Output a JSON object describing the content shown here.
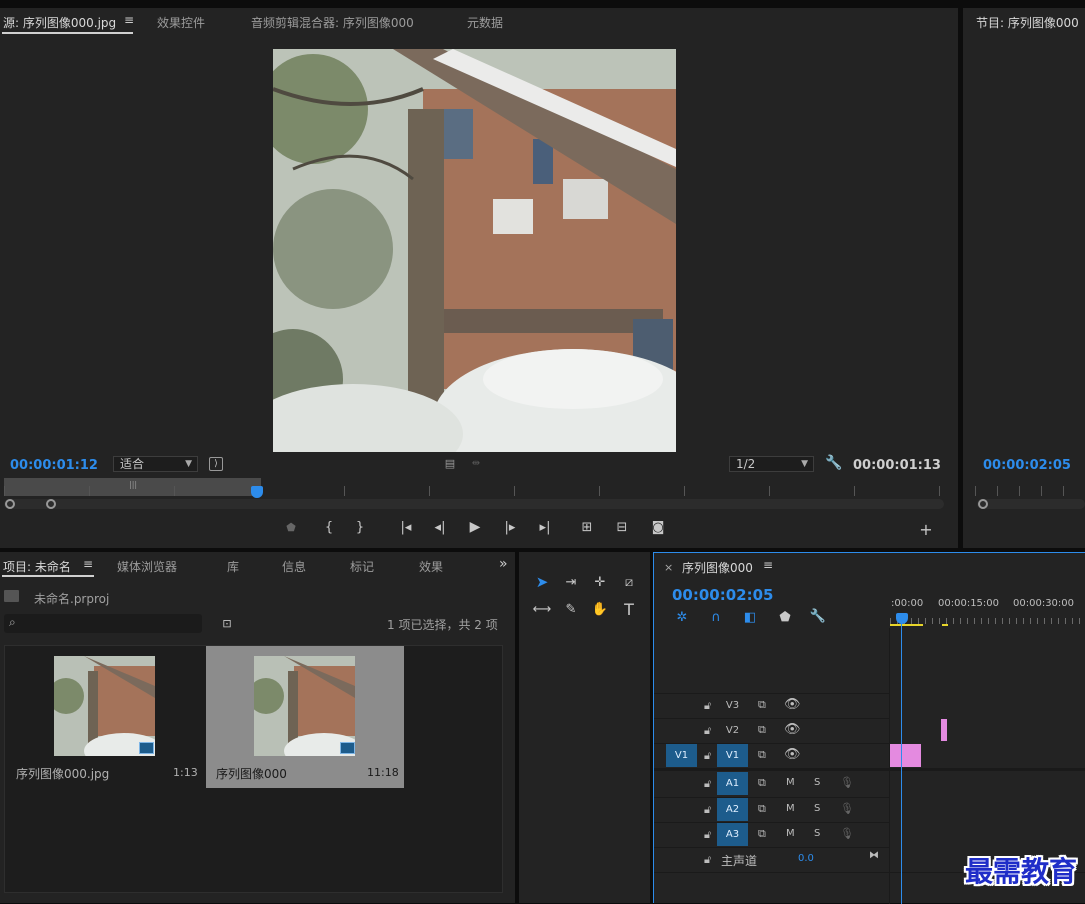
{
  "source_panel": {
    "tabs": [
      "源: 序列图像000.jpg",
      "效果控件",
      "音频剪辑混合器: 序列图像000",
      "元数据"
    ],
    "menu_icon": "hamburger-icon",
    "timecode_current": "00:00:01:12",
    "zoom_select": "适合",
    "resolution_select": "1/2",
    "timecode_duration": "00:00:01:13",
    "playhead_label": "|||"
  },
  "program_panel": {
    "title": "节目: 序列图像000",
    "timecode": "00:00:02:05"
  },
  "project_panel": {
    "tabs": [
      "项目: 未命名",
      "媒体浏览器",
      "库",
      "信息",
      "标记",
      "效果"
    ],
    "overflow": "»",
    "project_file": "未命名.prproj",
    "search_placeholder": "",
    "selection_status": "1 项已选择，共 2 项",
    "items": [
      {
        "name": "序列图像000.jpg",
        "duration": "1:13",
        "selected": false
      },
      {
        "name": "序列图像000",
        "duration": "11:18",
        "selected": true
      }
    ]
  },
  "timeline_panel": {
    "close": "×",
    "title": "序列图像000",
    "timecode": "00:00:02:05",
    "ruler_labels": [
      ":00:00",
      "00:00:15:00",
      "00:00:30:00"
    ],
    "video_tracks": [
      {
        "name": "V3",
        "source": ""
      },
      {
        "name": "V2",
        "source": ""
      },
      {
        "name": "V1",
        "source": "V1"
      }
    ],
    "audio_tracks": [
      {
        "name": "A1",
        "m": "M",
        "s": "S"
      },
      {
        "name": "A2",
        "m": "M",
        "s": "S"
      },
      {
        "name": "A3",
        "m": "M",
        "s": "S"
      }
    ],
    "master": {
      "label": "主声道",
      "value": "0.0"
    }
  },
  "watermark": "最需教育",
  "colors": {
    "accent_blue": "#2d8ceb",
    "clip_pink": "#e48ae0",
    "track_target": "#1d5c8c",
    "panel_bg": "#232323"
  }
}
